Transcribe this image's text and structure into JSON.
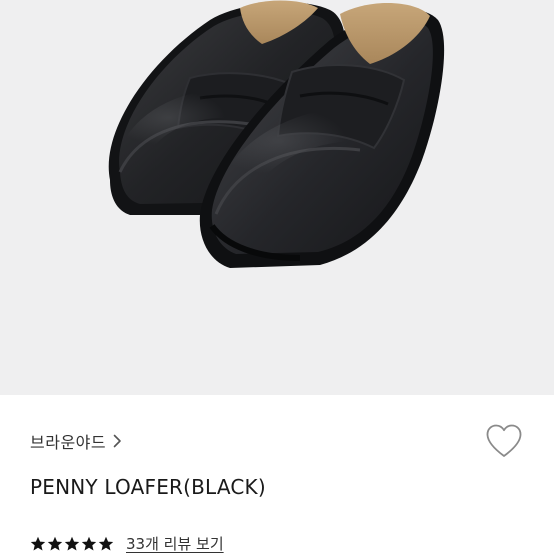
{
  "product": {
    "brand": "브라운야드",
    "title": "PENNY LOAFER(BLACK)",
    "rating": 5,
    "rating_max": 5,
    "reviews_link": "33개 리뷰 보기"
  },
  "icons": {
    "brand_link": "chevron-right-icon",
    "wishlist": "heart-outline-icon",
    "rating": "star-filled-icon"
  },
  "colors": {
    "image_background": "#efeff0",
    "text_primary": "#1a1a1a",
    "text_secondary": "#333333",
    "star": "#111111",
    "heart_outline": "#8a8a8a"
  }
}
